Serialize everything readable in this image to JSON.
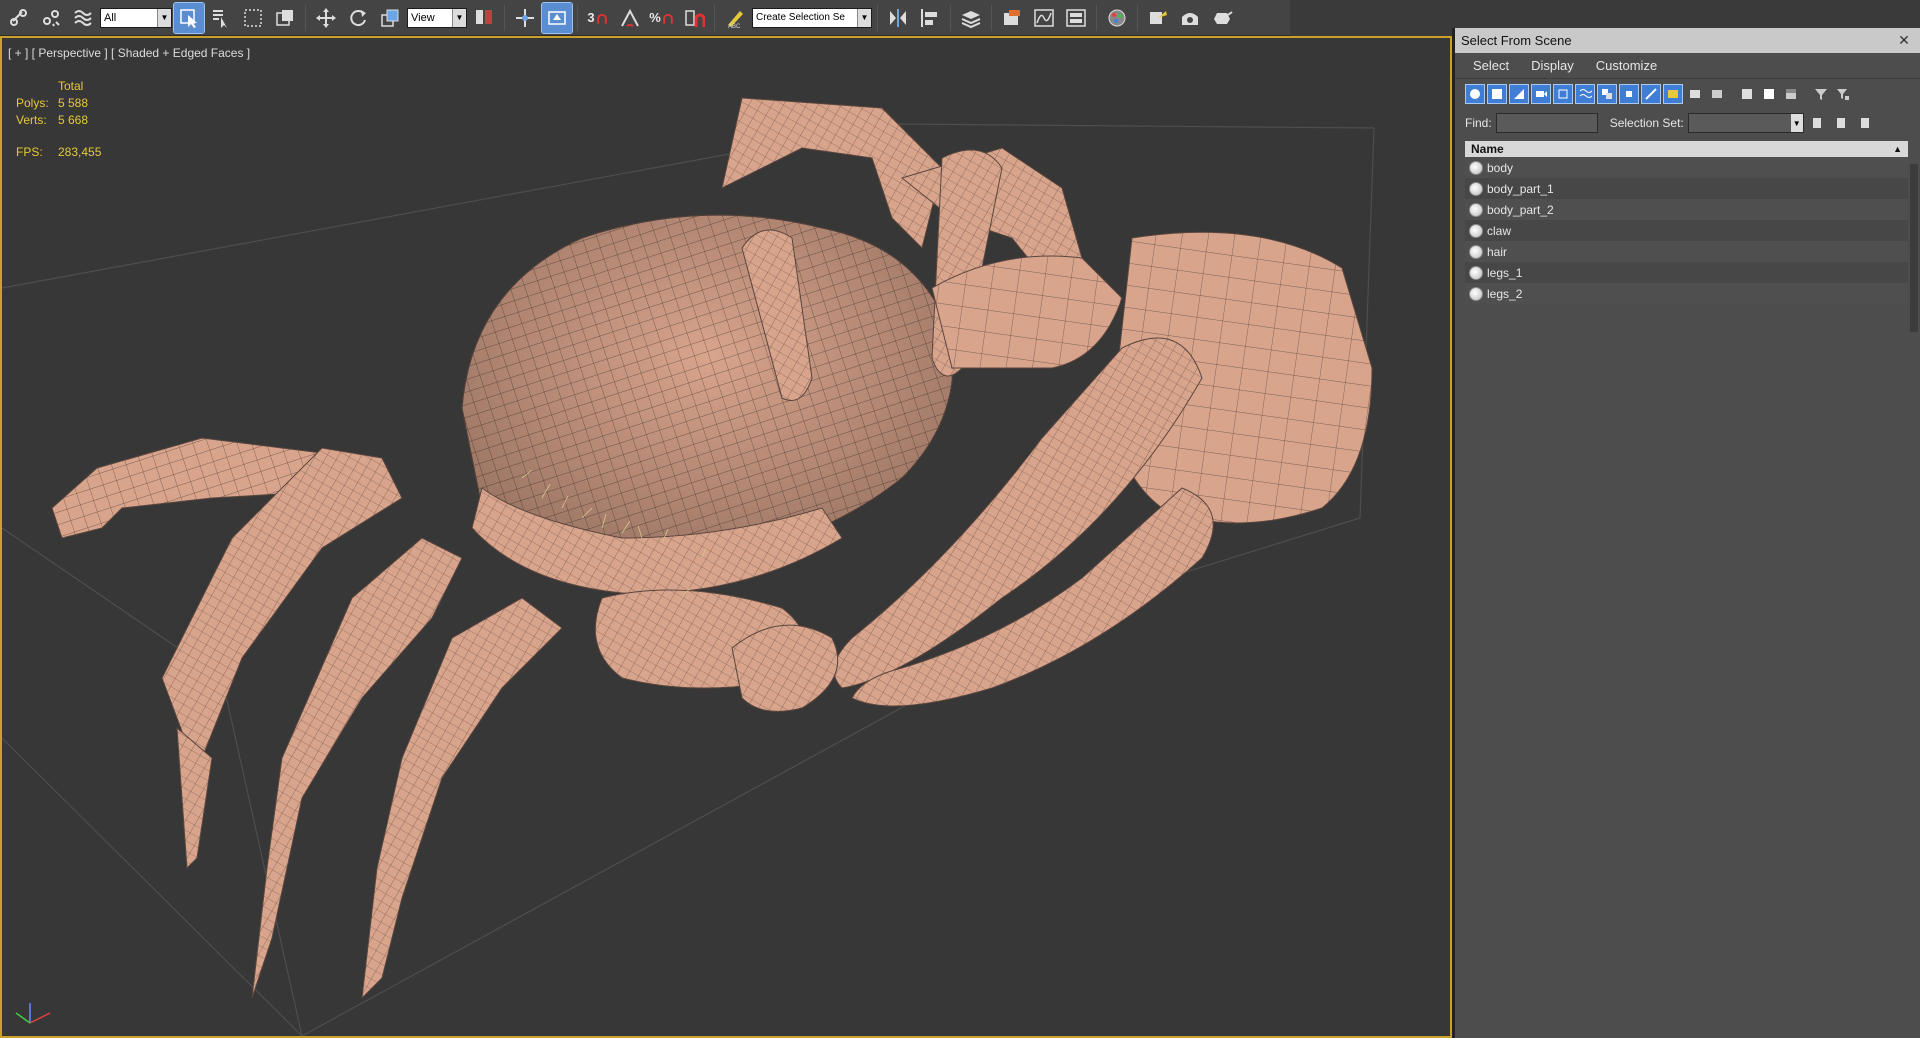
{
  "toolbar": {
    "filter_select": "All",
    "coord_select": "View",
    "snap_label": "3",
    "percent_label": "%",
    "selection_set_input": "Create Selection Se"
  },
  "viewport": {
    "label": "[ + ] [ Perspective ] [ Shaded + Edged Faces ]",
    "stats": {
      "header": "Total",
      "polys_label": "Polys:",
      "polys_value": "5 588",
      "verts_label": "Verts:",
      "verts_value": "5 668",
      "fps_label": "FPS:",
      "fps_value": "283,455"
    },
    "model_color": "#d9a48c",
    "accent_color": "#c8a02a"
  },
  "panel": {
    "title": "Select From Scene",
    "menu": [
      "Select",
      "Display",
      "Customize"
    ],
    "find_label": "Find:",
    "selection_set_label": "Selection Set:",
    "column_header": "Name",
    "objects": [
      "body",
      "body_part_1",
      "body_part_2",
      "claw",
      "hair",
      "legs_1",
      "legs_2"
    ]
  }
}
